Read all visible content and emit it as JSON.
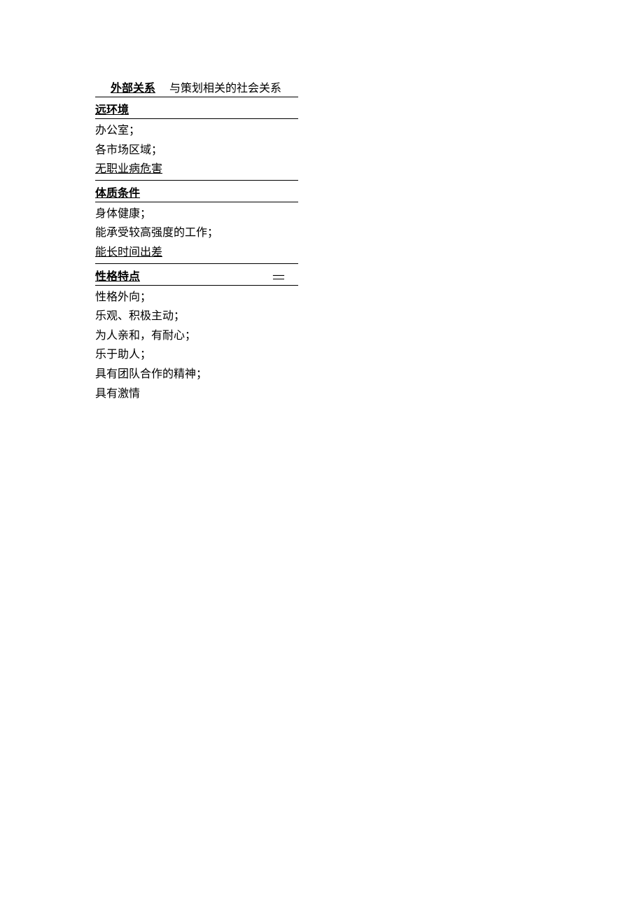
{
  "row1": {
    "label": "外部关系",
    "value": "与策划相关的社会关系"
  },
  "sections": [
    {
      "title": "远环境",
      "hasDash": false,
      "items": [
        {
          "text": "办公室；",
          "underlined": false
        },
        {
          "text": "各市场区域；",
          "underlined": false
        },
        {
          "text": "无职业病危害",
          "underlined": true
        }
      ]
    },
    {
      "title": "体质条件",
      "hasDash": false,
      "items": [
        {
          "text": "身体健康；",
          "underlined": false
        },
        {
          "text": "能承受较高强度的工作；",
          "underlined": false
        },
        {
          "text": "能长时间出差",
          "underlined": true
        }
      ]
    },
    {
      "title": "性格特点",
      "hasDash": true,
      "items": [
        {
          "text": "性格外向；",
          "underlined": false
        },
        {
          "text": "乐观、积极主动；",
          "underlined": false
        },
        {
          "text": "为人亲和，有耐心；",
          "underlined": false
        },
        {
          "text": "乐于助人；",
          "underlined": false
        },
        {
          "text": "具有团队合作的精神；",
          "underlined": false
        },
        {
          "text": "具有激情",
          "underlined": false
        }
      ]
    }
  ]
}
